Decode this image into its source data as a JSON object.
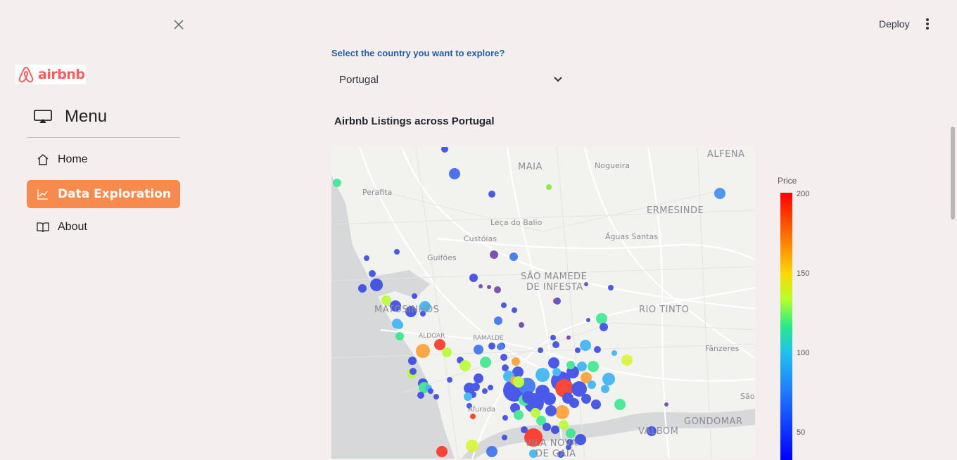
{
  "sidebar": {
    "logo_text": "airbnb",
    "menu_title": "Menu",
    "items": [
      {
        "label": "Home",
        "icon": "home-icon"
      },
      {
        "label": "Data Exploration",
        "icon": "chart-icon",
        "active": true
      },
      {
        "label": "About",
        "icon": "book-icon"
      }
    ]
  },
  "topbar": {
    "deploy_label": "Deploy"
  },
  "main": {
    "select_label": "Select the country you want to explore?",
    "selected_country": "Portugal",
    "section_title": "Airbnb Listings across Portugal"
  },
  "map": {
    "labels": {
      "maia": "MAIA",
      "nogueira": "Nogueira",
      "alfena": "ALFENA",
      "perafita": "Perafita",
      "ermesinde": "ERMESINDE",
      "leca": "Leça do Balio",
      "custoias": "Custóias",
      "aguas": "Águas Santas",
      "guifoes": "Guifões",
      "sao_mamede_1": "SÃO MAMEDE",
      "sao_mamede_2": "DE INFESTA",
      "matosinhos": "MATOSINHOS",
      "rio_tinto": "RIO TINTO",
      "aldoar": "ALDOAR",
      "ramalde": "RAMALDE",
      "fanzeres": "Fânzeres",
      "sao": "São",
      "afurada": "Afurada",
      "gondomar": "GONDOMAR",
      "valbom": "VALBOM",
      "vila_nova_1": "VILA NOVA",
      "vila_nova_2": "DE GAIA"
    }
  },
  "colorbar": {
    "title": "Price",
    "ticks": [
      "200",
      "150",
      "100",
      "50"
    ]
  }
}
